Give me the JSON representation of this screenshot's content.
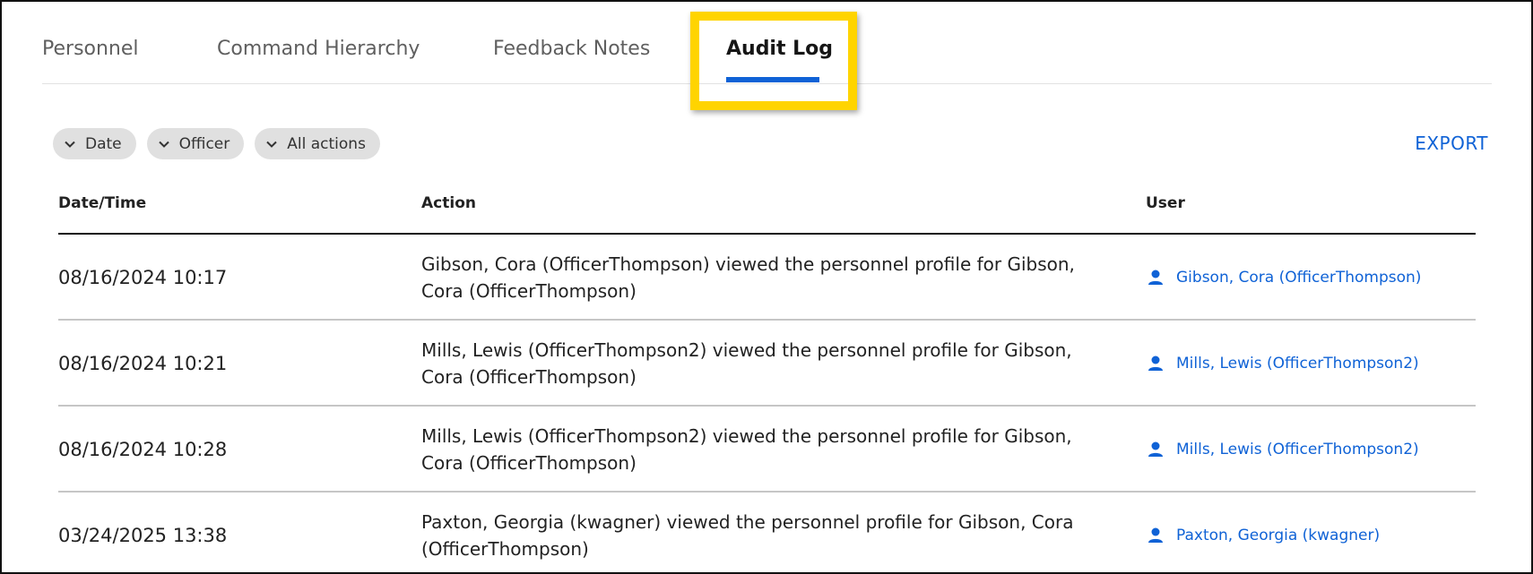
{
  "tabs": [
    {
      "label": "Personnel"
    },
    {
      "label": "Command Hierarchy"
    },
    {
      "label": "Feedback Notes"
    },
    {
      "label": "Audit Log",
      "active": true
    }
  ],
  "filters": [
    {
      "label": "Date",
      "icon": "chevron-down-icon"
    },
    {
      "label": "Officer",
      "icon": "chevron-down-icon"
    },
    {
      "label": "All actions",
      "icon": "chevron-down-icon"
    }
  ],
  "export_label": "EXPORT",
  "table": {
    "headers": [
      "Date/Time",
      "Action",
      "User"
    ],
    "rows": [
      {
        "datetime": "08/16/2024 10:17",
        "action": "Gibson, Cora (OfficerThompson) viewed the personnel profile for Gibson, Cora (OfficerThompson)",
        "user": "Gibson, Cora (OfficerThompson)"
      },
      {
        "datetime": "08/16/2024 10:21",
        "action": "Mills, Lewis (OfficerThompson2) viewed the personnel profile for Gibson, Cora (OfficerThompson)",
        "user": "Mills, Lewis (OfficerThompson2)"
      },
      {
        "datetime": "08/16/2024 10:28",
        "action": "Mills, Lewis (OfficerThompson2) viewed the personnel profile for Gibson, Cora (OfficerThompson)",
        "user": "Mills, Lewis (OfficerThompson2)"
      },
      {
        "datetime": "03/24/2025 13:38",
        "action": "Paxton, Georgia (kwagner) viewed the personnel profile for Gibson, Cora (OfficerThompson)",
        "user": "Paxton, Georgia (kwagner)"
      }
    ]
  },
  "colors": {
    "accent": "#0f62d6",
    "highlight": "#ffd400",
    "chip_bg": "#e0e0e0"
  }
}
